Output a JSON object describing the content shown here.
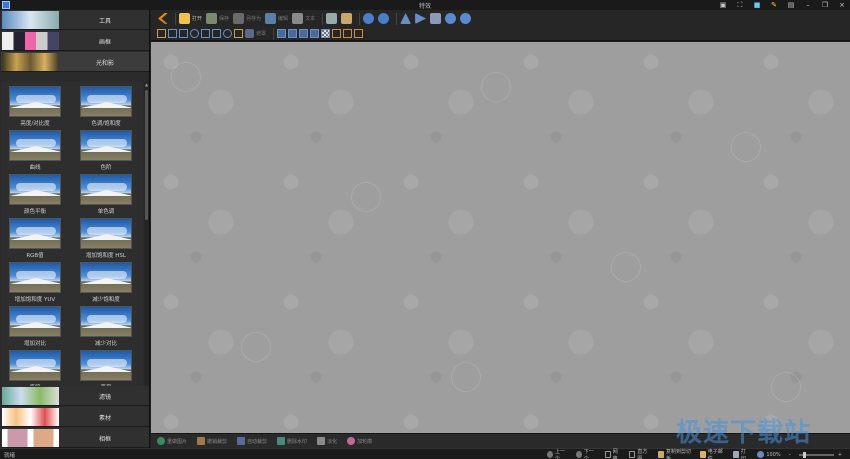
{
  "window": {
    "title": "特效"
  },
  "categories": [
    {
      "label": "工具"
    },
    {
      "label": "画框"
    },
    {
      "label": "光和影"
    },
    {
      "label": "滤镜"
    },
    {
      "label": "素材"
    },
    {
      "label": "相框"
    }
  ],
  "effects": [
    {
      "label": "亮度/对比度"
    },
    {
      "label": "色调/饱和度"
    },
    {
      "label": "曲线"
    },
    {
      "label": "色阶"
    },
    {
      "label": "颜色平衡"
    },
    {
      "label": "单色调"
    },
    {
      "label": "RGB值"
    },
    {
      "label": "增加饱和度 HSL"
    },
    {
      "label": "增加饱和度 YUV"
    },
    {
      "label": "减少饱和度"
    },
    {
      "label": "增加对比"
    },
    {
      "label": "减少对比"
    },
    {
      "label": "变暗"
    },
    {
      "label": "变亮"
    }
  ],
  "toolbar": {
    "open": "打开",
    "save": "保存",
    "save_as": "另存为",
    "edit": "编辑",
    "text": "文本",
    "mask": "遮罩"
  },
  "canvasbar": {
    "items": [
      "重做图片",
      "撤销裁剪",
      "自动裁剪",
      "删除水印",
      "淡化",
      "加轮廓"
    ]
  },
  "statusbar": {
    "status": "就绪",
    "prev": "上一个",
    "next": "下一个",
    "grid": "网格",
    "histogram": "直方图",
    "copy": "复制到剪切板",
    "email": "电子邮件",
    "print": "打印",
    "zoom": "100%"
  },
  "watermark": "极速下载站",
  "colors": {
    "accent": "#3a7bd5",
    "canvas": "#9e9e9e",
    "panel": "#2b2b2b"
  }
}
